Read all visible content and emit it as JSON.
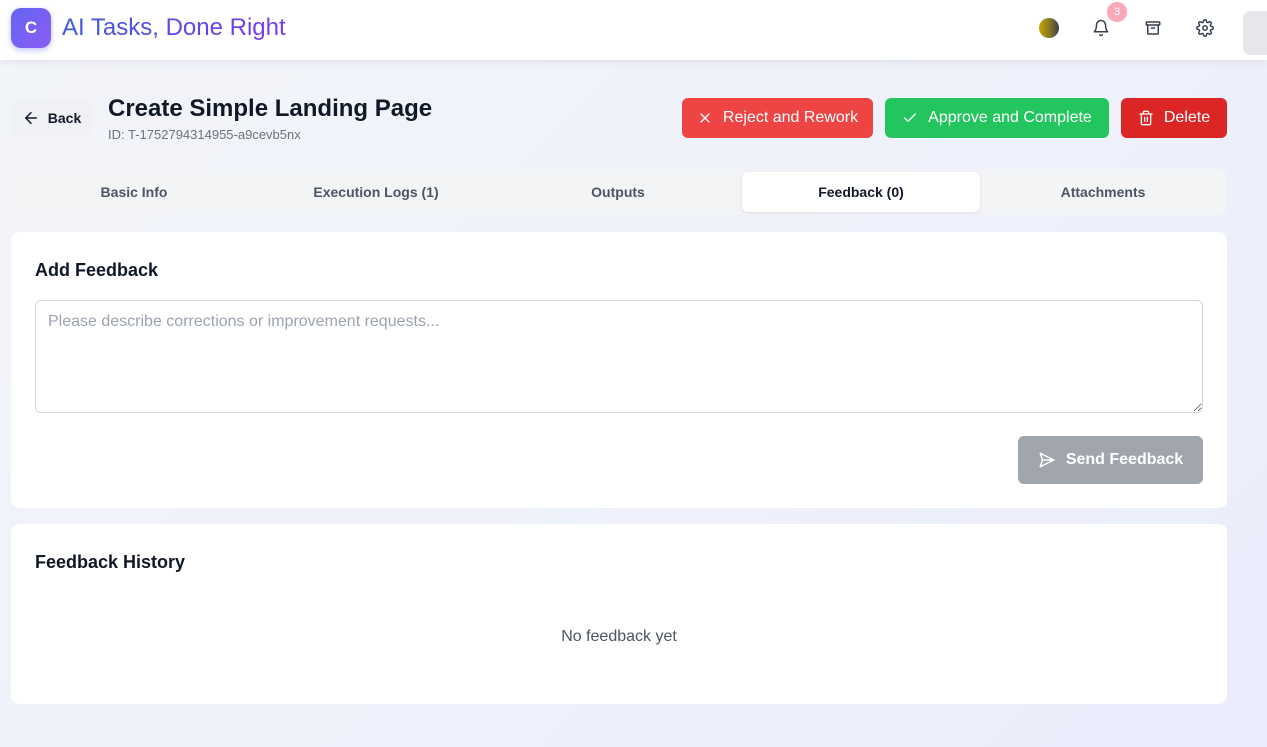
{
  "header": {
    "logo_letter": "C",
    "app_title": "AI Tasks, Done Right",
    "notification_count": "3",
    "icons": [
      "theme-toggle-icon",
      "bell-icon",
      "archive-icon",
      "gear-icon"
    ]
  },
  "page": {
    "back_label": "Back",
    "title": "Create Simple Landing Page",
    "task_id": "ID: T-1752794314955-a9cevb5nx"
  },
  "actions": {
    "reject_label": "Reject and Rework",
    "approve_label": "Approve and Complete",
    "delete_label": "Delete"
  },
  "tabs": [
    {
      "label": "Basic Info",
      "active": false
    },
    {
      "label": "Execution Logs (1)",
      "active": false
    },
    {
      "label": "Outputs",
      "active": false
    },
    {
      "label": "Feedback (0)",
      "active": true
    },
    {
      "label": "Attachments",
      "active": false
    }
  ],
  "feedback_form": {
    "title": "Add Feedback",
    "placeholder": "Please describe corrections or improvement requests...",
    "value": "",
    "send_label": "Send Feedback"
  },
  "history": {
    "title": "Feedback History",
    "empty_text": "No feedback yet"
  },
  "colors": {
    "reject": "#ef4444",
    "approve": "#22c55e",
    "delete": "#dc2626",
    "send_disabled": "#a0a5ae",
    "brand_start": "#6366f1",
    "brand_end": "#8b5cf6"
  }
}
